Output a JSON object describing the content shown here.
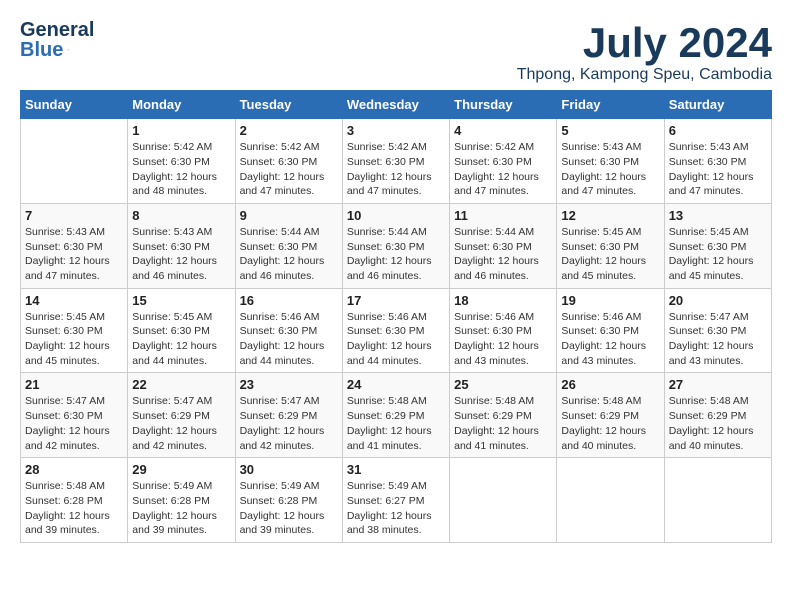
{
  "header": {
    "logo_line1": "General",
    "logo_line2": "Blue",
    "month_year": "July 2024",
    "location": "Thpong, Kampong Speu, Cambodia"
  },
  "weekdays": [
    "Sunday",
    "Monday",
    "Tuesday",
    "Wednesday",
    "Thursday",
    "Friday",
    "Saturday"
  ],
  "weeks": [
    [
      {
        "day": "",
        "info": ""
      },
      {
        "day": "1",
        "info": "Sunrise: 5:42 AM\nSunset: 6:30 PM\nDaylight: 12 hours\nand 48 minutes."
      },
      {
        "day": "2",
        "info": "Sunrise: 5:42 AM\nSunset: 6:30 PM\nDaylight: 12 hours\nand 47 minutes."
      },
      {
        "day": "3",
        "info": "Sunrise: 5:42 AM\nSunset: 6:30 PM\nDaylight: 12 hours\nand 47 minutes."
      },
      {
        "day": "4",
        "info": "Sunrise: 5:42 AM\nSunset: 6:30 PM\nDaylight: 12 hours\nand 47 minutes."
      },
      {
        "day": "5",
        "info": "Sunrise: 5:43 AM\nSunset: 6:30 PM\nDaylight: 12 hours\nand 47 minutes."
      },
      {
        "day": "6",
        "info": "Sunrise: 5:43 AM\nSunset: 6:30 PM\nDaylight: 12 hours\nand 47 minutes."
      }
    ],
    [
      {
        "day": "7",
        "info": "Sunrise: 5:43 AM\nSunset: 6:30 PM\nDaylight: 12 hours\nand 47 minutes."
      },
      {
        "day": "8",
        "info": "Sunrise: 5:43 AM\nSunset: 6:30 PM\nDaylight: 12 hours\nand 46 minutes."
      },
      {
        "day": "9",
        "info": "Sunrise: 5:44 AM\nSunset: 6:30 PM\nDaylight: 12 hours\nand 46 minutes."
      },
      {
        "day": "10",
        "info": "Sunrise: 5:44 AM\nSunset: 6:30 PM\nDaylight: 12 hours\nand 46 minutes."
      },
      {
        "day": "11",
        "info": "Sunrise: 5:44 AM\nSunset: 6:30 PM\nDaylight: 12 hours\nand 46 minutes."
      },
      {
        "day": "12",
        "info": "Sunrise: 5:45 AM\nSunset: 6:30 PM\nDaylight: 12 hours\nand 45 minutes."
      },
      {
        "day": "13",
        "info": "Sunrise: 5:45 AM\nSunset: 6:30 PM\nDaylight: 12 hours\nand 45 minutes."
      }
    ],
    [
      {
        "day": "14",
        "info": "Sunrise: 5:45 AM\nSunset: 6:30 PM\nDaylight: 12 hours\nand 45 minutes."
      },
      {
        "day": "15",
        "info": "Sunrise: 5:45 AM\nSunset: 6:30 PM\nDaylight: 12 hours\nand 44 minutes."
      },
      {
        "day": "16",
        "info": "Sunrise: 5:46 AM\nSunset: 6:30 PM\nDaylight: 12 hours\nand 44 minutes."
      },
      {
        "day": "17",
        "info": "Sunrise: 5:46 AM\nSunset: 6:30 PM\nDaylight: 12 hours\nand 44 minutes."
      },
      {
        "day": "18",
        "info": "Sunrise: 5:46 AM\nSunset: 6:30 PM\nDaylight: 12 hours\nand 43 minutes."
      },
      {
        "day": "19",
        "info": "Sunrise: 5:46 AM\nSunset: 6:30 PM\nDaylight: 12 hours\nand 43 minutes."
      },
      {
        "day": "20",
        "info": "Sunrise: 5:47 AM\nSunset: 6:30 PM\nDaylight: 12 hours\nand 43 minutes."
      }
    ],
    [
      {
        "day": "21",
        "info": "Sunrise: 5:47 AM\nSunset: 6:30 PM\nDaylight: 12 hours\nand 42 minutes."
      },
      {
        "day": "22",
        "info": "Sunrise: 5:47 AM\nSunset: 6:29 PM\nDaylight: 12 hours\nand 42 minutes."
      },
      {
        "day": "23",
        "info": "Sunrise: 5:47 AM\nSunset: 6:29 PM\nDaylight: 12 hours\nand 42 minutes."
      },
      {
        "day": "24",
        "info": "Sunrise: 5:48 AM\nSunset: 6:29 PM\nDaylight: 12 hours\nand 41 minutes."
      },
      {
        "day": "25",
        "info": "Sunrise: 5:48 AM\nSunset: 6:29 PM\nDaylight: 12 hours\nand 41 minutes."
      },
      {
        "day": "26",
        "info": "Sunrise: 5:48 AM\nSunset: 6:29 PM\nDaylight: 12 hours\nand 40 minutes."
      },
      {
        "day": "27",
        "info": "Sunrise: 5:48 AM\nSunset: 6:29 PM\nDaylight: 12 hours\nand 40 minutes."
      }
    ],
    [
      {
        "day": "28",
        "info": "Sunrise: 5:48 AM\nSunset: 6:28 PM\nDaylight: 12 hours\nand 39 minutes."
      },
      {
        "day": "29",
        "info": "Sunrise: 5:49 AM\nSunset: 6:28 PM\nDaylight: 12 hours\nand 39 minutes."
      },
      {
        "day": "30",
        "info": "Sunrise: 5:49 AM\nSunset: 6:28 PM\nDaylight: 12 hours\nand 39 minutes."
      },
      {
        "day": "31",
        "info": "Sunrise: 5:49 AM\nSunset: 6:27 PM\nDaylight: 12 hours\nand 38 minutes."
      },
      {
        "day": "",
        "info": ""
      },
      {
        "day": "",
        "info": ""
      },
      {
        "day": "",
        "info": ""
      }
    ]
  ]
}
